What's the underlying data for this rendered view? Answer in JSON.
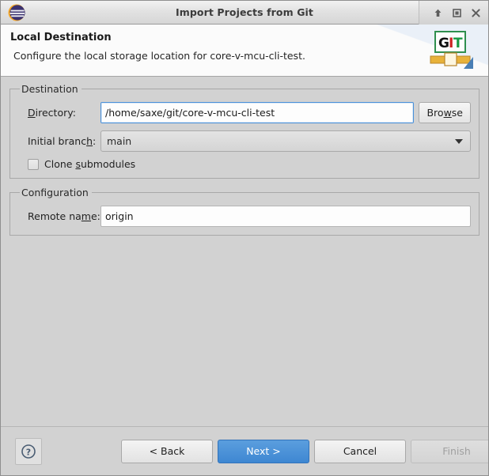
{
  "window": {
    "title": "Import Projects from Git",
    "app_icon": "eclipse-logo-icon",
    "controls": {
      "minimize": "shade-up-icon",
      "maximize": "maximize-icon",
      "close": "close-icon"
    }
  },
  "header": {
    "title": "Local Destination",
    "description": "Configure the local storage location for core-v-mcu-cli-test.",
    "logo": "git-logo-icon",
    "logo_text": {
      "g": "G",
      "i": "I",
      "t": "T"
    }
  },
  "destination": {
    "group_label": "Destination",
    "directory": {
      "label_pre": "D",
      "label_post": "irectory:",
      "value": "/home/saxe/git/core-v-mcu-cli-test",
      "placeholder": "",
      "focused": true
    },
    "browse": {
      "label_pre": "Bro",
      "label_mn": "w",
      "label_post": "se"
    },
    "initial_branch": {
      "label_pre": "Initial branc",
      "label_mn": "h",
      "label_post": ":",
      "value": "main",
      "options": [
        "main"
      ]
    },
    "clone_submodules": {
      "label_pre": "Clone ",
      "label_mn": "s",
      "label_post": "ubmodules",
      "checked": false
    }
  },
  "configuration": {
    "group_label": "Configuration",
    "remote_name": {
      "label_pre": "Remote na",
      "label_mn": "m",
      "label_post": "e:",
      "value": "origin",
      "placeholder": ""
    }
  },
  "footer": {
    "help": "?",
    "back": "< Back",
    "next": "Next >",
    "cancel": "Cancel",
    "finish": "Finish"
  },
  "colors": {
    "accent": "#4a90d9",
    "body_bg": "#d2d2d2",
    "header_bg": "#fbfbfb",
    "disabled_text": "#a0a0a0"
  }
}
